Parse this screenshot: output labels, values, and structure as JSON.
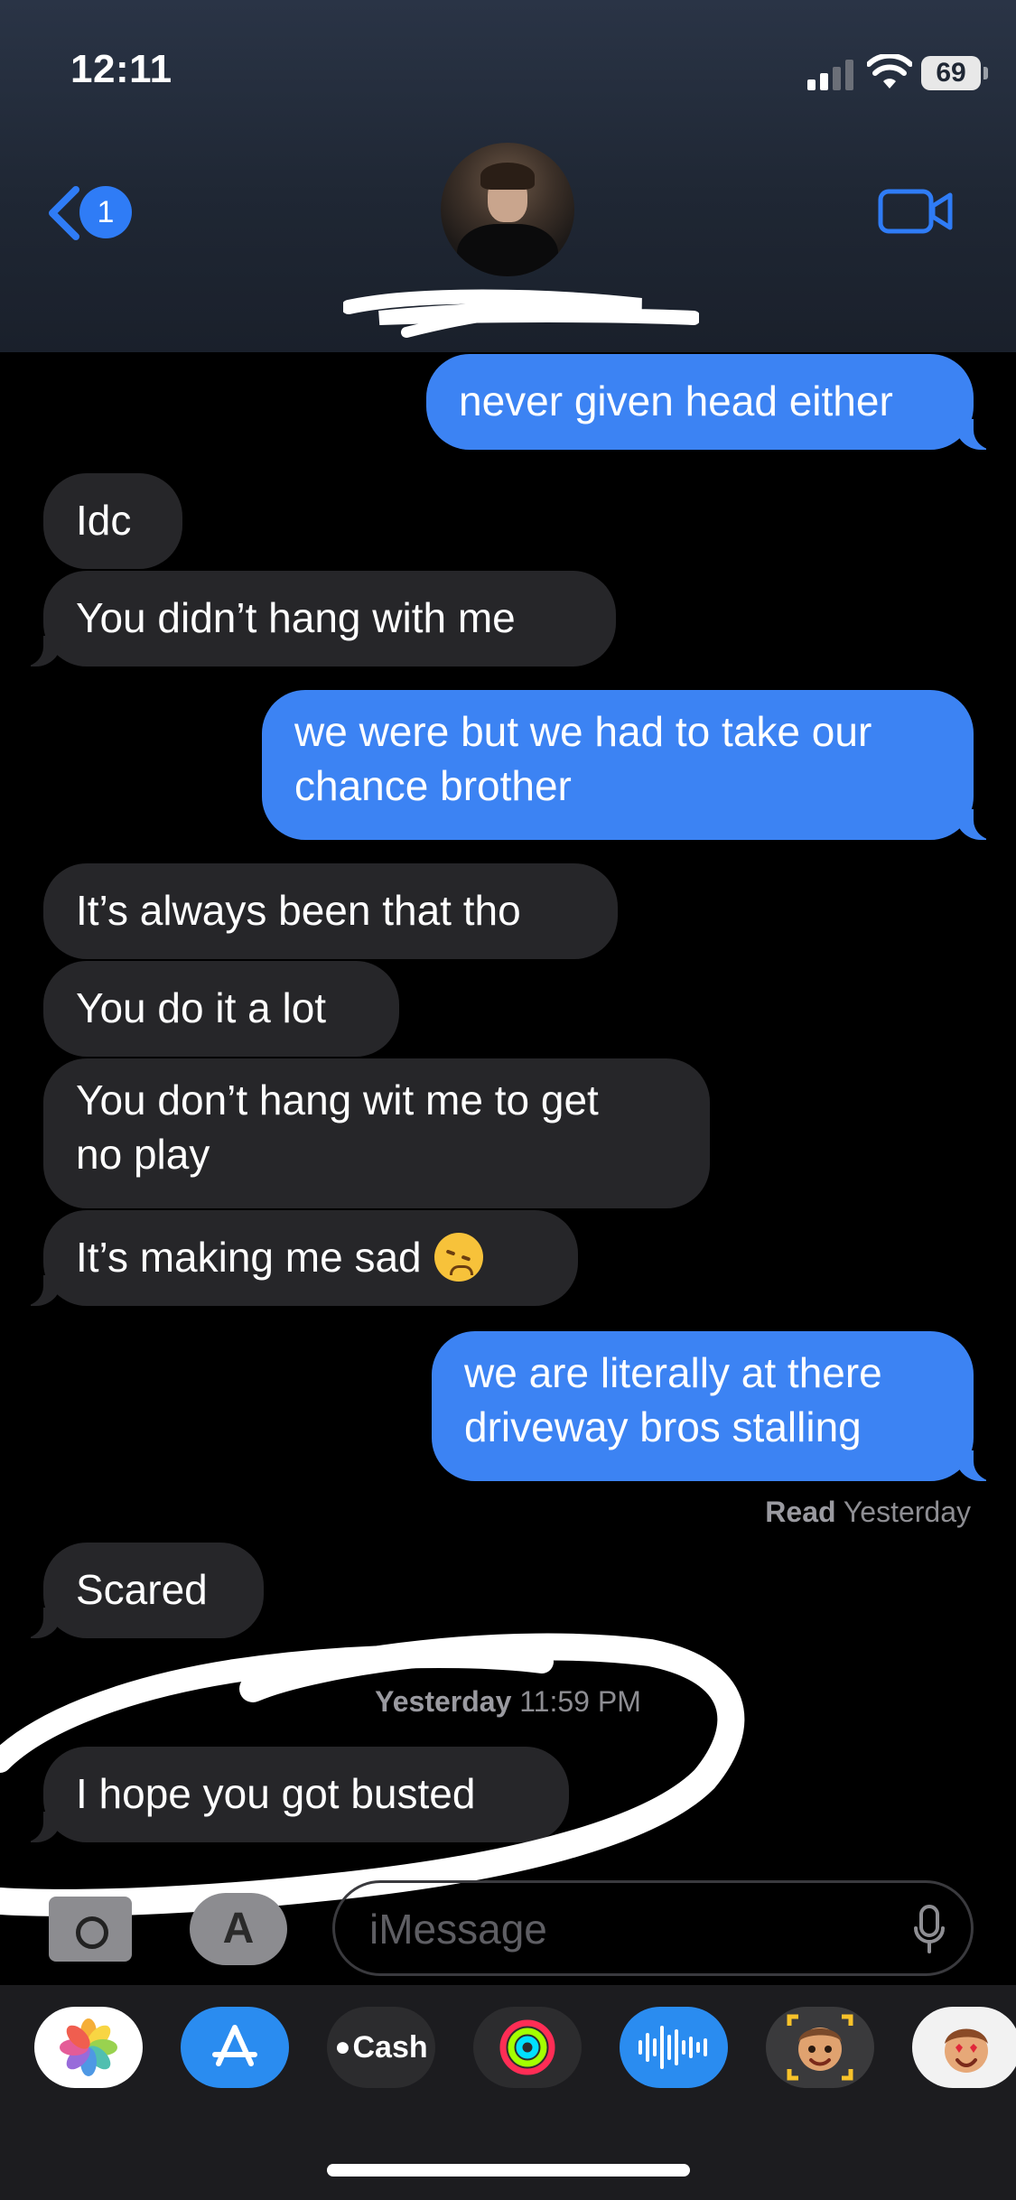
{
  "status_bar": {
    "time": "12:11",
    "battery": "69"
  },
  "header": {
    "unread_count": "1"
  },
  "messages": [
    {
      "text": "never given head either"
    },
    {
      "text": "Idc"
    },
    {
      "text": "You didn’t hang with me"
    },
    {
      "line1": "we were but we had to take our",
      "line2": "chance brother"
    },
    {
      "text": "It’s always been that tho"
    },
    {
      "text": "You do it a lot"
    },
    {
      "line1": "You don’t hang wit me to get",
      "line2": "no play"
    },
    {
      "text": "It’s making me sad"
    },
    {
      "line1": "we are literally at there",
      "line2": "driveway bros stalling"
    },
    {
      "text": "Scared"
    },
    {
      "text": "I hope you got busted"
    }
  ],
  "read_receipt": {
    "label": "Read",
    "when": "Yesterday"
  },
  "timestamp": {
    "day": "Yesterday",
    "time": "11:59 PM"
  },
  "input": {
    "placeholder": "iMessage"
  },
  "app_drawer": {
    "cash_label": "Cash",
    "icons": [
      "photos-icon",
      "app-store-icon",
      "apple-cash-icon",
      "fitness-icon",
      "audio-message-icon",
      "memoji-icon",
      "memoji-stickers-icon"
    ]
  },
  "colors": {
    "sent_bubble": "#3c83f3",
    "received_bubble": "#262629",
    "accent": "#2f7cf6"
  }
}
